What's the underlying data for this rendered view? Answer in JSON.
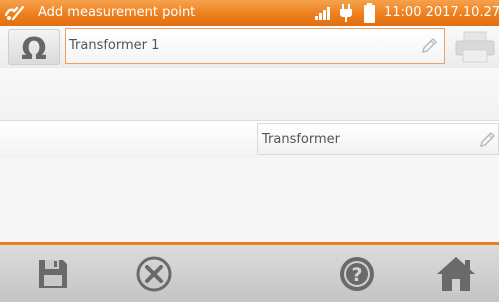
{
  "header": {
    "title": "Add measurement point",
    "clock": "11:00 2017.10.27"
  },
  "form": {
    "name_value": "Transformer 1",
    "type_value": "Transformer"
  },
  "colors": {
    "accent": "#ef7d1a",
    "icon_gray": "#6a6a6a"
  },
  "icons": {
    "header": [
      "measurement-icon",
      "signal-icon",
      "plug-icon",
      "battery-icon"
    ],
    "form": [
      "omega-icon",
      "pencil-icon",
      "printer-icon"
    ],
    "toolbar": [
      "save-icon",
      "cancel-icon",
      "help-icon",
      "home-icon"
    ]
  }
}
